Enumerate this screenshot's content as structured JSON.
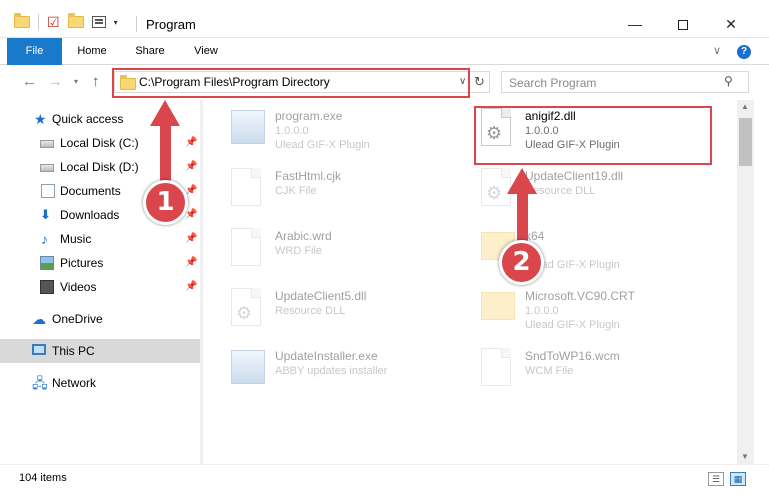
{
  "window": {
    "title": "Program",
    "minimize": "—",
    "close": "✕"
  },
  "ribbon": {
    "tabs": [
      {
        "label": "File"
      },
      {
        "label": "Home"
      },
      {
        "label": "Share"
      },
      {
        "label": "View"
      }
    ],
    "collapse": "∨",
    "help": "?"
  },
  "nav": {
    "back": "←",
    "forward": "→",
    "recent": "▾",
    "up": "↑"
  },
  "address": {
    "path": "C:\\Program Files\\Program Directory",
    "dropdown": "∨",
    "refresh": "↻"
  },
  "search": {
    "placeholder": "Search Program",
    "icon": "search-icon"
  },
  "sidebar": {
    "items": [
      {
        "label": "Quick access",
        "icon": "star-icon",
        "pinned": false
      },
      {
        "label": "Local Disk (C:)",
        "icon": "drive-icon",
        "pinned": true
      },
      {
        "label": "Local Disk (D:)",
        "icon": "drive-icon",
        "pinned": true
      },
      {
        "label": "Documents",
        "icon": "documents-icon",
        "pinned": true
      },
      {
        "label": "Downloads",
        "icon": "downloads-icon",
        "pinned": true
      },
      {
        "label": "Music",
        "icon": "music-icon",
        "pinned": true
      },
      {
        "label": "Pictures",
        "icon": "pictures-icon",
        "pinned": true
      },
      {
        "label": "Videos",
        "icon": "videos-icon",
        "pinned": true
      },
      {
        "label": "OneDrive",
        "icon": "onedrive-icon",
        "pinned": false
      },
      {
        "label": "This PC",
        "icon": "this-pc-icon",
        "pinned": false,
        "selected": true
      },
      {
        "label": "Network",
        "icon": "network-icon",
        "pinned": false
      }
    ]
  },
  "files": [
    {
      "name": "program.exe",
      "line1": "1.0.0.0",
      "line2": "Ulead GIF-X Plugin",
      "icon": "exe-icon",
      "faded": true
    },
    {
      "name": "anigif2.dll",
      "line1": "1.0.0.0",
      "line2": "Ulead GIF-X Plugin",
      "icon": "dll-icon",
      "faded": false,
      "highlighted": true
    },
    {
      "name": "FastHtml.cjk",
      "line1": "CJK File",
      "line2": "",
      "icon": "file-icon",
      "faded": true
    },
    {
      "name": "UpdateClient19.dll",
      "line1": "Resource DLL",
      "line2": "",
      "icon": "dll-icon",
      "faded": true
    },
    {
      "name": "Arabic.wrd",
      "line1": "WRD File",
      "line2": "",
      "icon": "file-icon",
      "faded": true
    },
    {
      "name": "x64",
      "line1": "Ulead GIF-X Plugin",
      "line2": "",
      "icon": "folder-icon",
      "faded": true
    },
    {
      "name": "UpdateClient5.dll",
      "line1": "Resource DLL",
      "line2": "",
      "icon": "dll-icon",
      "faded": true
    },
    {
      "name": "Microsoft.VC90.CRT",
      "line1": "1.0.0.0",
      "line2": "Ulead GIF-X Plugin",
      "icon": "folder-icon",
      "faded": true
    },
    {
      "name": "UpdateInstaller.exe",
      "line1": "ABBY updates installer",
      "line2": "",
      "icon": "exe-icon",
      "faded": true
    },
    {
      "name": "SndToWP16.wcm",
      "line1": "WCM File",
      "line2": "",
      "icon": "file-icon",
      "faded": true
    }
  ],
  "status": {
    "count": "104 items",
    "view_details": "☰",
    "view_tiles": "▦"
  },
  "annotations": {
    "badge1": "1",
    "badge2": "2",
    "color": "#d9474c"
  },
  "colors": {
    "accent": "#1979ca",
    "selection": "#d9d9d9",
    "annotation": "#d9474c"
  }
}
